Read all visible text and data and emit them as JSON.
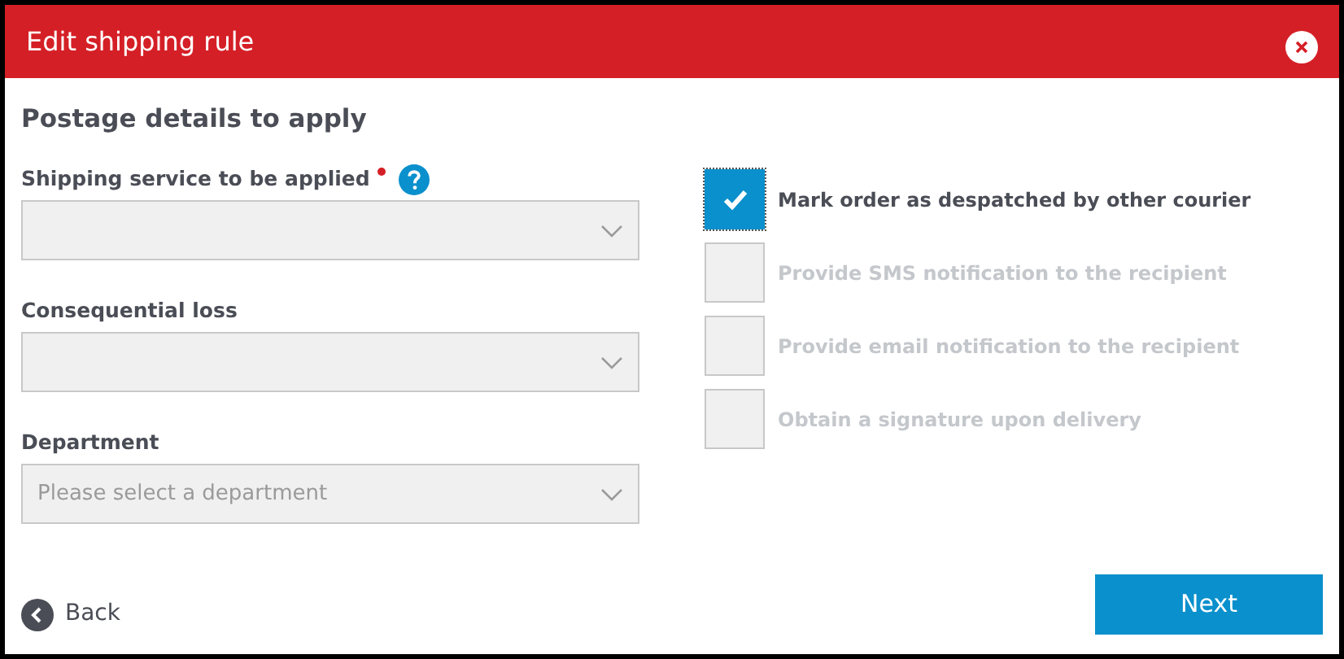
{
  "window": {
    "title": "Edit shipping rule"
  },
  "section_title": "Postage details to apply",
  "fields": [
    {
      "label": "Shipping service to be applied",
      "required": true,
      "help": true
    },
    {
      "label": "Consequential loss",
      "required": false,
      "help": false
    },
    {
      "label": "Department",
      "required": false,
      "help": false,
      "placeholder": "Please select a department"
    }
  ],
  "options": [
    {
      "label": "Mark order as despatched by other courier",
      "checked": true,
      "disabled": false
    },
    {
      "label": "Provide SMS notification to the recipient",
      "checked": false,
      "disabled": true
    },
    {
      "label": "Provide email notification to the recipient",
      "checked": false,
      "disabled": true
    },
    {
      "label": "Obtain a signature upon delivery",
      "checked": false,
      "disabled": true
    }
  ],
  "back_label": "Back",
  "next_label": "Next"
}
